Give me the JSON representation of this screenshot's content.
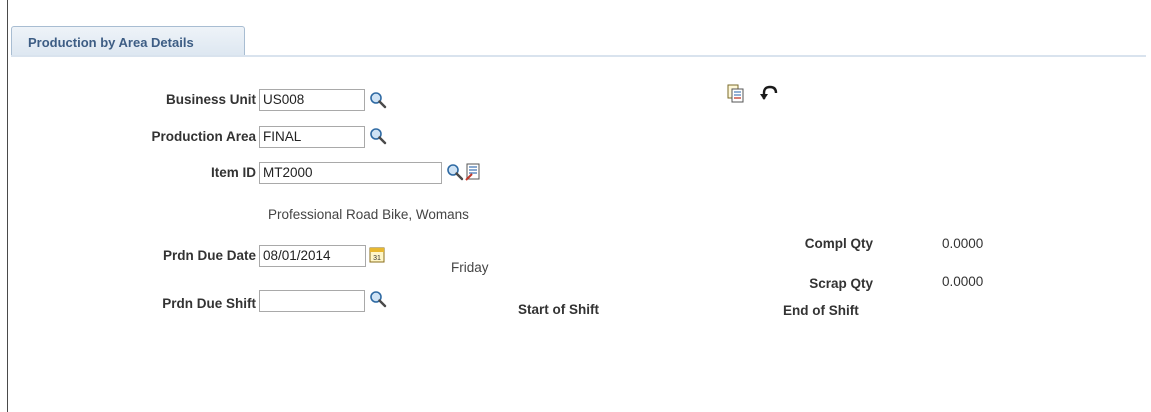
{
  "tab": {
    "label": "Production by Area Details"
  },
  "fields": {
    "business_unit": {
      "label": "Business Unit",
      "value": "US008"
    },
    "production_area": {
      "label": "Production Area",
      "value": "FINAL"
    },
    "item_id": {
      "label": "Item ID",
      "value": "MT2000"
    },
    "item_description": "Professional Road Bike, Womans",
    "prdn_due_date": {
      "label": "Prdn Due Date",
      "value": "08/01/2014"
    },
    "day_name": "Friday",
    "prdn_due_shift": {
      "label": "Prdn Due Shift",
      "value": ""
    }
  },
  "quantities": {
    "compl_qty": {
      "label": "Compl Qty",
      "value": "0.0000"
    },
    "scrap_qty": {
      "label": "Scrap Qty",
      "value": "0.0000"
    }
  },
  "shift_labels": {
    "start": "Start of Shift",
    "end": "End of Shift"
  },
  "icons": {
    "lookup": "search-icon",
    "item_detail": "item-detail-icon",
    "calendar": "calendar-icon",
    "report": "report-icon",
    "return": "return-icon"
  },
  "colors": {
    "tab_text": "#3d5d84",
    "tab_border": "#a8bdd2"
  }
}
